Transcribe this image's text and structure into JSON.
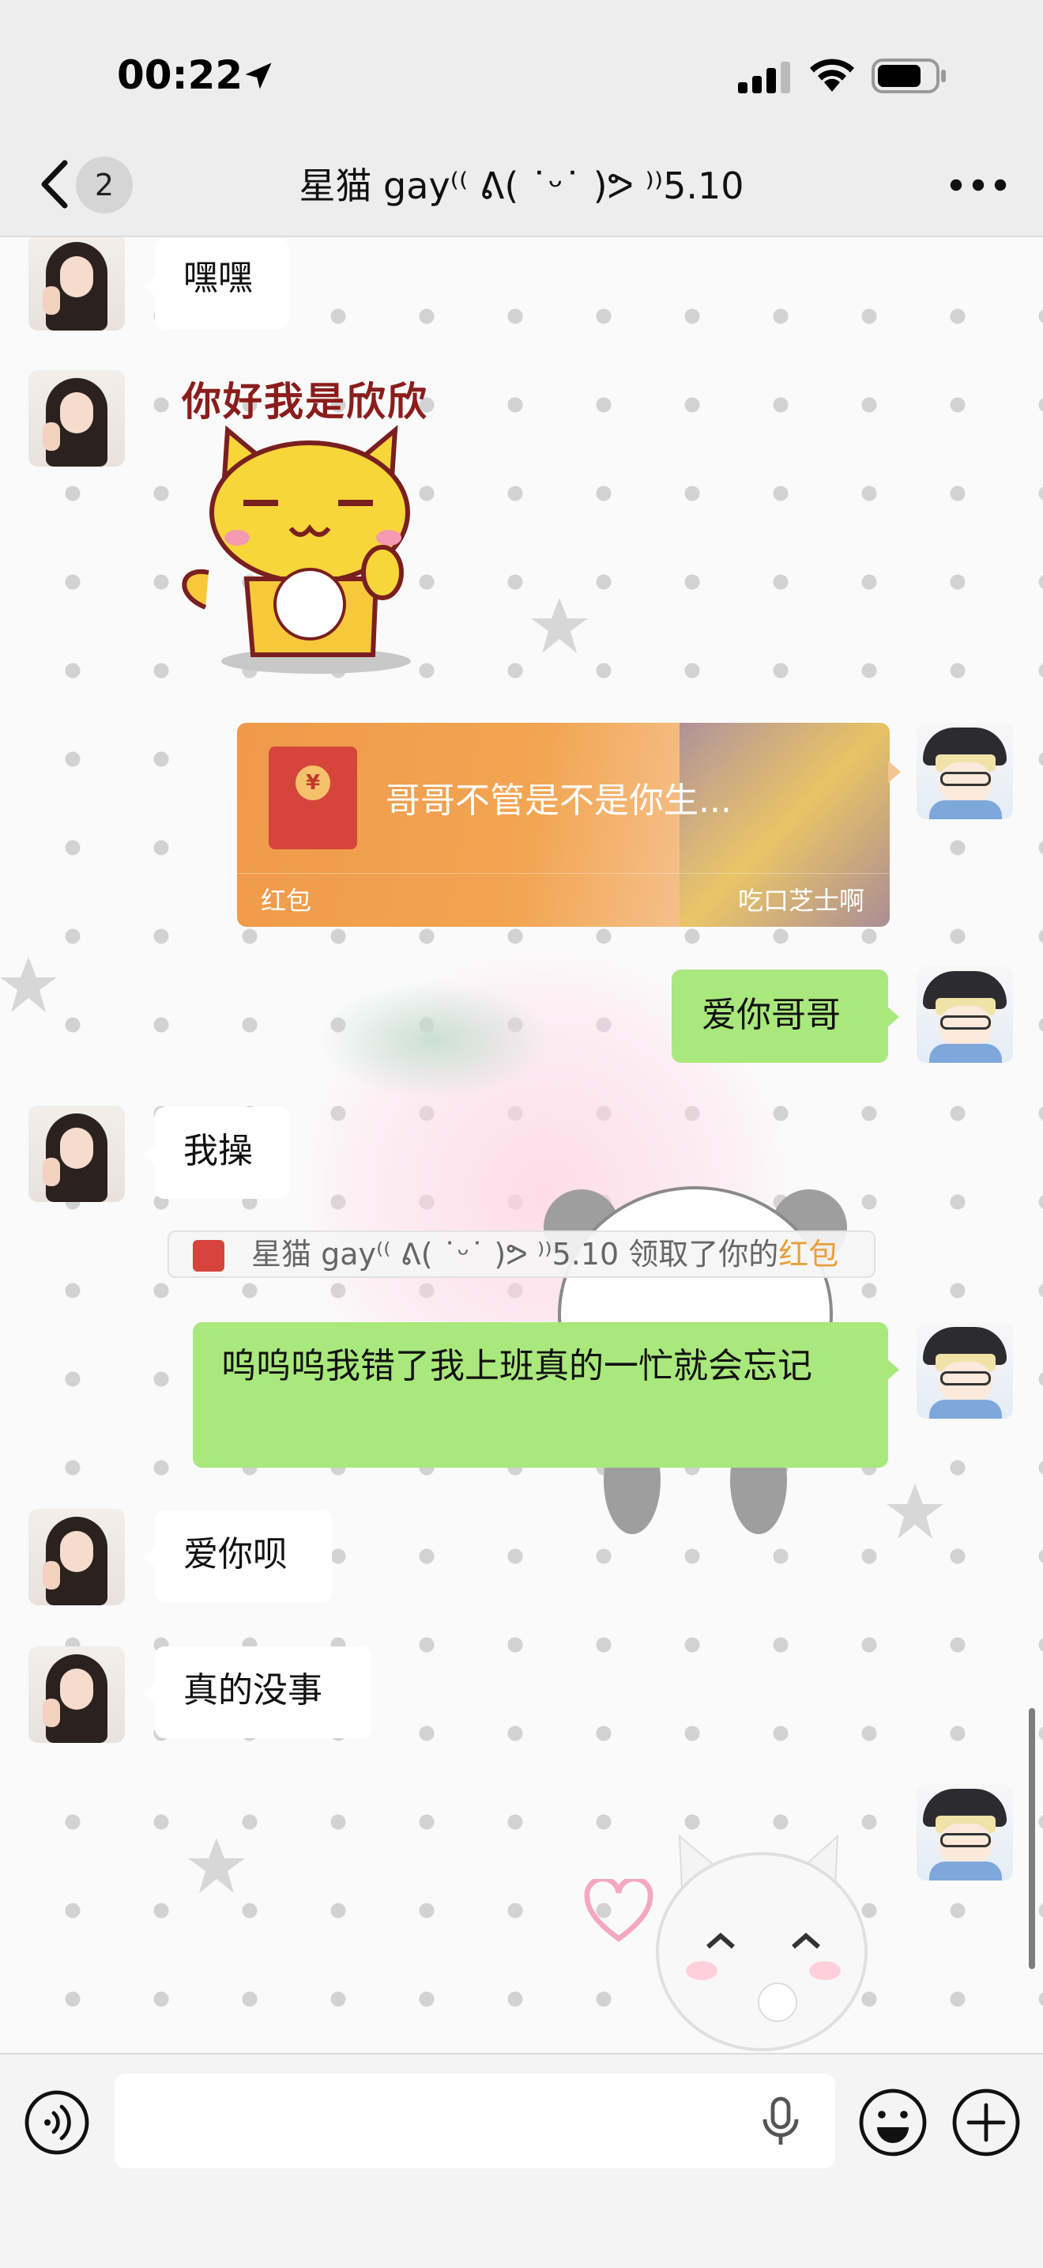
{
  "status_bar": {
    "time": "00:22",
    "icons": [
      "location-arrow-icon",
      "cellular-signal-icon",
      "wifi-icon",
      "battery-icon"
    ]
  },
  "nav": {
    "back_icon": "chevron-left-icon",
    "unread_count": "2",
    "title": "星猫 gay⁽⁽ ᕕ( ˙ᵕ˙ )ᕗ ⁾⁾5.10",
    "more_icon": "more-dots-icon"
  },
  "messages": [
    {
      "side": "left",
      "type": "text",
      "text": "嘿嘿"
    },
    {
      "side": "left",
      "type": "sticker",
      "caption": "你好我是欣欣"
    },
    {
      "side": "right",
      "type": "red_packet",
      "title": "哥哥不管是不是你生...",
      "label": "红包",
      "sender": "吃口芝士啊"
    },
    {
      "side": "right",
      "type": "text",
      "text": "爱你哥哥"
    },
    {
      "side": "left",
      "type": "text",
      "text": "我操"
    },
    {
      "side": "right",
      "type": "text",
      "text": "呜呜呜我错了我上班真的一忙就会忘记"
    },
    {
      "side": "left",
      "type": "text",
      "text": "爱你呗"
    },
    {
      "side": "left",
      "type": "text",
      "text": "真的没事"
    }
  ],
  "system_notice": {
    "prefix": "星猫 gay⁽⁽ ᕕ( ˙ᵕ˙ )ᕗ ⁾⁾5.10 领取了你的",
    "highlight": "红包"
  },
  "composer": {
    "voice_icon": "voice-toggle-icon",
    "input_value": "",
    "mic_icon": "microphone-icon",
    "emoji_icon": "emoji-icon",
    "plus_icon": "plus-icon"
  },
  "colors": {
    "right_bubble": "#a9e87c",
    "left_bubble": "#ffffff",
    "red_packet": "#f2a552",
    "highlight": "#e8a03a"
  }
}
